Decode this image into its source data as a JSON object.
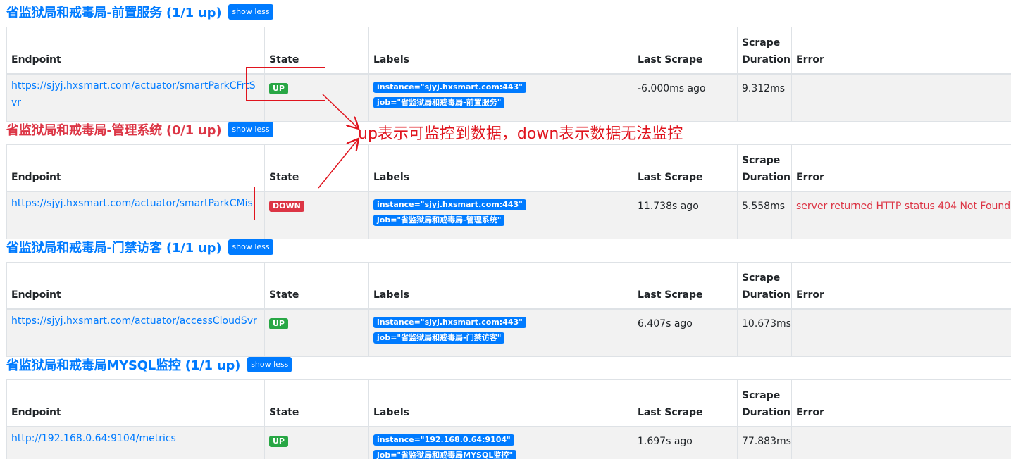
{
  "columns": {
    "endpoint": "Endpoint",
    "state": "State",
    "labels": "Labels",
    "last_scrape": "Last Scrape",
    "scrape_line1": "Scrape",
    "scrape_line2": "Duration",
    "error": "Error"
  },
  "groups": [
    {
      "title": "省监狱局和戒毒局-前置服务 (1/1 up)",
      "title_color": "#007bff",
      "button": "show less",
      "target": {
        "endpoint": "https://sjyj.hxsmart.com/actuator/smartParkCFrtSvr",
        "state": "UP",
        "labels": [
          "instance=\"sjyj.hxsmart.com:443\"",
          "job=\"省监狱局和戒毒局-前置服务\""
        ],
        "last_scrape": "-6.000ms ago",
        "scrape_duration": "9.312ms",
        "error": ""
      }
    },
    {
      "title": "省监狱局和戒毒局-管理系统 (0/1 up)",
      "title_color": "#dc3545",
      "button": "show less",
      "target": {
        "endpoint": "https://sjyj.hxsmart.com/actuator/smartParkCMis",
        "state": "DOWN",
        "labels": [
          "instance=\"sjyj.hxsmart.com:443\"",
          "job=\"省监狱局和戒毒局-管理系统\""
        ],
        "last_scrape": "11.738s ago",
        "scrape_duration": "5.558ms",
        "error": "server returned HTTP status 404 Not Found"
      }
    },
    {
      "title": "省监狱局和戒毒局-门禁访客 (1/1 up)",
      "title_color": "#007bff",
      "button": "show less",
      "target": {
        "endpoint": "https://sjyj.hxsmart.com/actuator/accessCloudSvr",
        "state": "UP",
        "labels": [
          "instance=\"sjyj.hxsmart.com:443\"",
          "job=\"省监狱局和戒毒局-门禁访客\""
        ],
        "last_scrape": "6.407s ago",
        "scrape_duration": "10.673ms",
        "error": ""
      }
    },
    {
      "title": "省监狱局和戒毒局MYSQL监控 (1/1 up)",
      "title_color": "#007bff",
      "button": "show less",
      "target": {
        "endpoint": "http://192.168.0.64:9104/metrics",
        "state": "UP",
        "labels": [
          "instance=\"192.168.0.64:9104\"",
          "job=\"省监狱局和戒毒局MYSQL监控\""
        ],
        "last_scrape": "1.697s ago",
        "scrape_duration": "77.883ms",
        "error": ""
      }
    }
  ],
  "annotation": {
    "text": "up表示可监控到数据，down表示数据无法监控",
    "color": "#e0141e"
  },
  "colors": {
    "link": "#007bff",
    "up": "#28a745",
    "down": "#dc3545",
    "label_badge": "#007bff"
  }
}
